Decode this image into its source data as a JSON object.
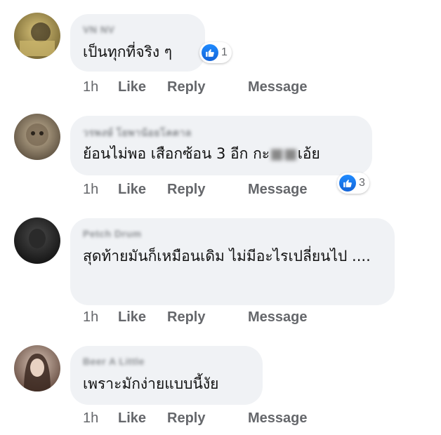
{
  "comments": [
    {
      "name": "VN NV",
      "text": "เป็นทุกที่จริง ๆ",
      "time": "1h",
      "like": "Like",
      "reply": "Reply",
      "message": "Message",
      "reactions": "1"
    },
    {
      "name": "วรพงษ์ โยพาน้อยโคตาล",
      "text_before": "ย้อนไม่พอ เสือกซ้อน 3 อีก กะ",
      "text_after": "เอ้ย",
      "time": "1h",
      "like": "Like",
      "reply": "Reply",
      "message": "Message",
      "reactions": "3"
    },
    {
      "name": "Petch Drum",
      "text": "สุดท้ายมันก็เหมือนเดิม ไม่มีอะไรเปลี่ยนไป ....",
      "time": "1h",
      "like": "Like",
      "reply": "Reply",
      "message": "Message"
    },
    {
      "name": "Beer A Little",
      "text": "เพราะมักง่ายแบบนี้งัย",
      "time": "1h",
      "like": "Like",
      "reply": "Reply",
      "message": "Message"
    }
  ],
  "colors": {
    "bubble": "#f0f2f5",
    "action_text": "#65676b",
    "like_blue": "#1877f2"
  },
  "icons": {
    "like_reaction": "thumbs-up-icon"
  }
}
